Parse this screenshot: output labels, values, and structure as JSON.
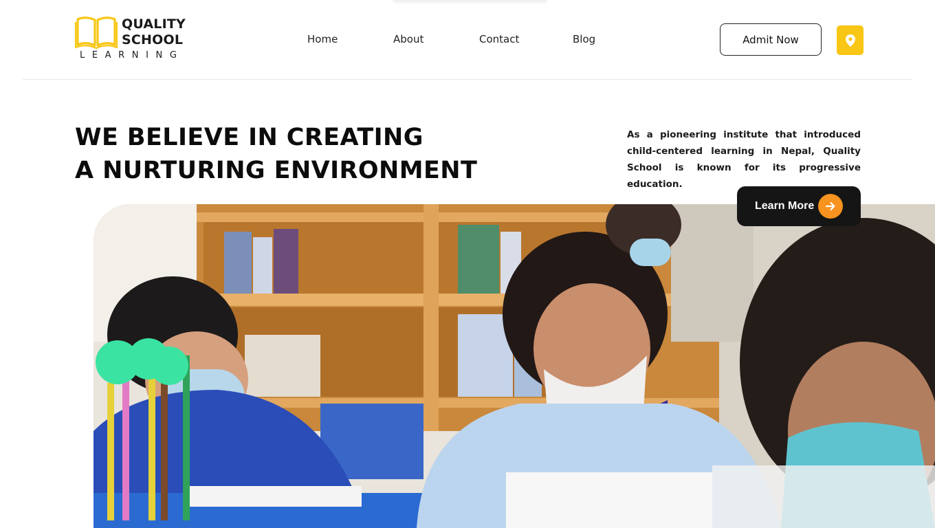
{
  "logo": {
    "line1": "QUALITY",
    "line2": "SCHOOL",
    "line3": "LEARNING",
    "icon": "open-book-icon",
    "accent": "#f8c614"
  },
  "nav": {
    "items": [
      {
        "label": "Home"
      },
      {
        "label": "About"
      },
      {
        "label": "Contact"
      },
      {
        "label": "Blog"
      }
    ]
  },
  "actions": {
    "admit_label": "Admit Now",
    "location_icon": "map-pin-icon",
    "location_color": "#f8c614"
  },
  "hero": {
    "title_line1": "WE BELIEVE IN CREATING",
    "title_line2": "A NURTURING ENVIRONMENT",
    "description": "As a pioneering institute that introduced child-centered learning in Nepal, Quality School is known for its progressive education.",
    "learn_more_label": "Learn More",
    "learn_more_icon": "arrow-right-icon",
    "button_color": "#151515",
    "arrow_color": "#f7931e"
  },
  "photo": {
    "subject": "classroom-students-photo"
  }
}
